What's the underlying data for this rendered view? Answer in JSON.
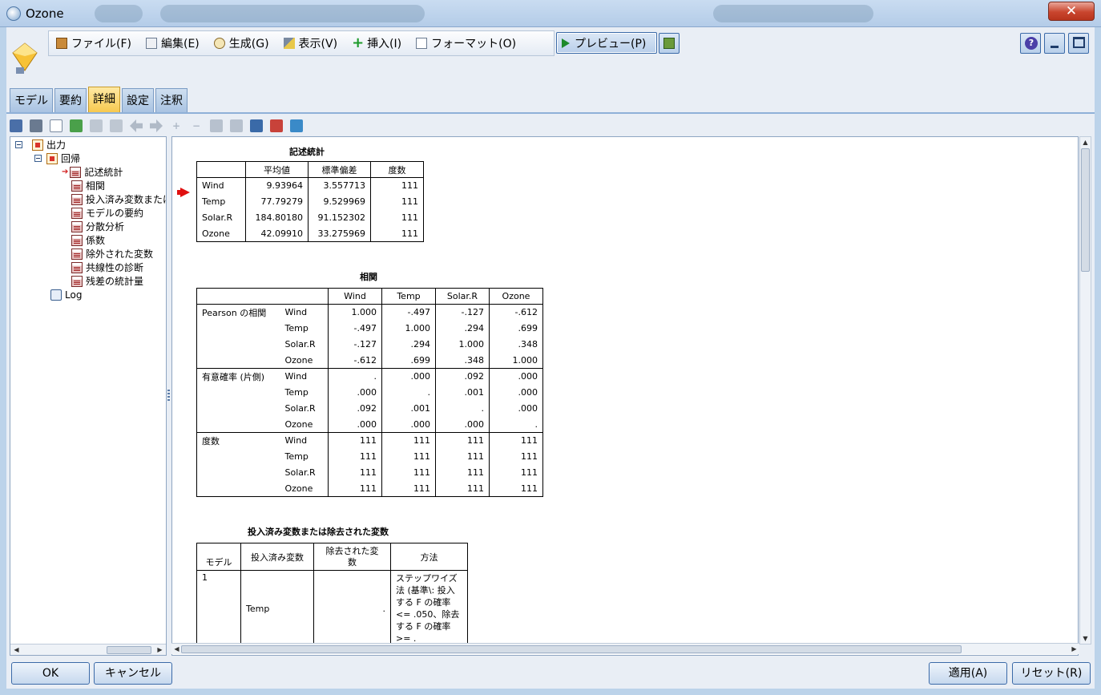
{
  "window": {
    "title": "Ozone",
    "close_label": "✕"
  },
  "menu": {
    "file": "ファイル(F)",
    "edit": "編集(E)",
    "generate": "生成(G)",
    "view": "表示(V)",
    "insert": "挿入(I)",
    "format": "フォーマット(O)",
    "preview": "プレビュー(P)"
  },
  "help_label": "?",
  "tabs": [
    "モデル",
    "要約",
    "詳細",
    "設定",
    "注釈"
  ],
  "active_tab": "詳細",
  "tree": {
    "root": "出力",
    "child": "回帰",
    "items": [
      "記述統計",
      "相関",
      "投入済み変数または",
      "モデルの要約",
      "分散分析",
      "係数",
      "除外された変数",
      "共線性の診断",
      "残差の統計量"
    ],
    "log": "Log"
  },
  "descriptives": {
    "title": "記述統計",
    "headers": [
      "平均値",
      "標準偏差",
      "度数"
    ],
    "rows": [
      {
        "name": "Wind",
        "mean": "9.93964",
        "sd": "3.557713",
        "n": "111"
      },
      {
        "name": "Temp",
        "mean": "77.79279",
        "sd": "9.529969",
        "n": "111"
      },
      {
        "name": "Solar.R",
        "mean": "184.80180",
        "sd": "91.152302",
        "n": "111"
      },
      {
        "name": "Ozone",
        "mean": "42.09910",
        "sd": "33.275969",
        "n": "111"
      }
    ]
  },
  "correlations": {
    "title": "相関",
    "columns": [
      "Wind",
      "Temp",
      "Solar.R",
      "Ozone"
    ],
    "groups": [
      {
        "label": "Pearson の相関",
        "rows": [
          {
            "var": "Wind",
            "vals": [
              "1.000",
              "-.497",
              "-.127",
              "-.612"
            ]
          },
          {
            "var": "Temp",
            "vals": [
              "-.497",
              "1.000",
              ".294",
              ".699"
            ]
          },
          {
            "var": "Solar.R",
            "vals": [
              "-.127",
              ".294",
              "1.000",
              ".348"
            ]
          },
          {
            "var": "Ozone",
            "vals": [
              "-.612",
              ".699",
              ".348",
              "1.000"
            ]
          }
        ]
      },
      {
        "label": "有意確率 (片側)",
        "rows": [
          {
            "var": "Wind",
            "vals": [
              ".",
              ".000",
              ".092",
              ".000"
            ]
          },
          {
            "var": "Temp",
            "vals": [
              ".000",
              ".",
              ".001",
              ".000"
            ]
          },
          {
            "var": "Solar.R",
            "vals": [
              ".092",
              ".001",
              ".",
              ".000"
            ]
          },
          {
            "var": "Ozone",
            "vals": [
              ".000",
              ".000",
              ".000",
              "."
            ]
          }
        ]
      },
      {
        "label": "度数",
        "rows": [
          {
            "var": "Wind",
            "vals": [
              "111",
              "111",
              "111",
              "111"
            ]
          },
          {
            "var": "Temp",
            "vals": [
              "111",
              "111",
              "111",
              "111"
            ]
          },
          {
            "var": "Solar.R",
            "vals": [
              "111",
              "111",
              "111",
              "111"
            ]
          },
          {
            "var": "Ozone",
            "vals": [
              "111",
              "111",
              "111",
              "111"
            ]
          }
        ]
      }
    ]
  },
  "variables_entered": {
    "title": "投入済み変数または除去された変数",
    "headers": [
      "モデル",
      "投入済み変数",
      "除去された変\n数",
      "方法"
    ],
    "row": {
      "model": "1",
      "entered": "Temp",
      "removed": ".",
      "method": "ステップワイズ法 (基準\\: 投入する F の確率 <= .050、除去する F の確率 >= ."
    }
  },
  "buttons": {
    "ok": "OK",
    "cancel": "キャンセル",
    "apply": "適用(A)",
    "reset": "リセット(R)"
  }
}
